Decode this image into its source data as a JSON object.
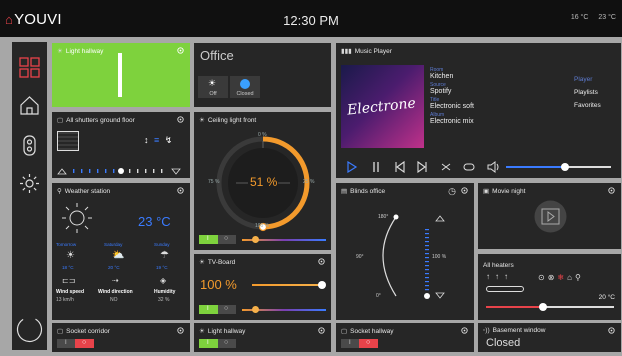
{
  "header": {
    "logo": "YOUVI",
    "time": "12:30 PM",
    "temp_outdoor": "16 °C",
    "temp_indoor": "23 °C"
  },
  "tiles": {
    "light_hallway_top": {
      "title": "Light hallway"
    },
    "office": {
      "title": "Office",
      "scene_off": "Off",
      "scene_closed": "Closed"
    },
    "shutters": {
      "title": "All shutters ground floor"
    },
    "ceiling": {
      "title": "Ceiling light front",
      "value": "51 %",
      "t0": "0 %",
      "t25": "25 %",
      "t75": "75 %",
      "t100": "100 %"
    },
    "weather": {
      "title": "Weather station",
      "temp": "23 °C",
      "days": [
        {
          "label": "Tomorrow",
          "temp": "18 °C"
        },
        {
          "label": "Saturday",
          "temp": "20 °C"
        },
        {
          "label": "Sunday",
          "temp": "19 °C"
        }
      ],
      "wind_speed_label": "Wind speed",
      "wind_speed": "13 km/h",
      "wind_dir_label": "Wind direction",
      "wind_dir": "NO",
      "humidity_label": "Humidity",
      "humidity": "32 %"
    },
    "music": {
      "title": "Music Player",
      "room_label": "Room",
      "room": "Kitchen",
      "source_label": "Source",
      "source": "Spotify",
      "title_label": "Title",
      "track": "Electronic soft",
      "album_label": "Album",
      "album": "Electronic mix",
      "cover_text": "Electrone",
      "menu": [
        "Player",
        "Playlists",
        "Favorites"
      ],
      "volume": 0.55
    },
    "tvboard": {
      "title": "TV-Board",
      "value": "100 %"
    },
    "blinds": {
      "title": "Blinds office",
      "a180": "180°",
      "a90": "90°",
      "a0": "0°",
      "pct": "100 %"
    },
    "movie": {
      "title": "Movie night"
    },
    "heaters": {
      "title": "All heaters",
      "temp": "20 °C"
    },
    "socket_corridor": {
      "title": "Socket corridor"
    },
    "light_hallway_bottom": {
      "title": "Light hallway"
    },
    "socket_hallway": {
      "title": "Socket hallway"
    },
    "basement": {
      "title": "Basement window",
      "state": "Closed"
    }
  },
  "colors": {
    "accent_green": "#7ed23d",
    "accent_orange": "#f39a2c",
    "accent_blue": "#3a7bff",
    "accent_red": "#e8434a"
  }
}
